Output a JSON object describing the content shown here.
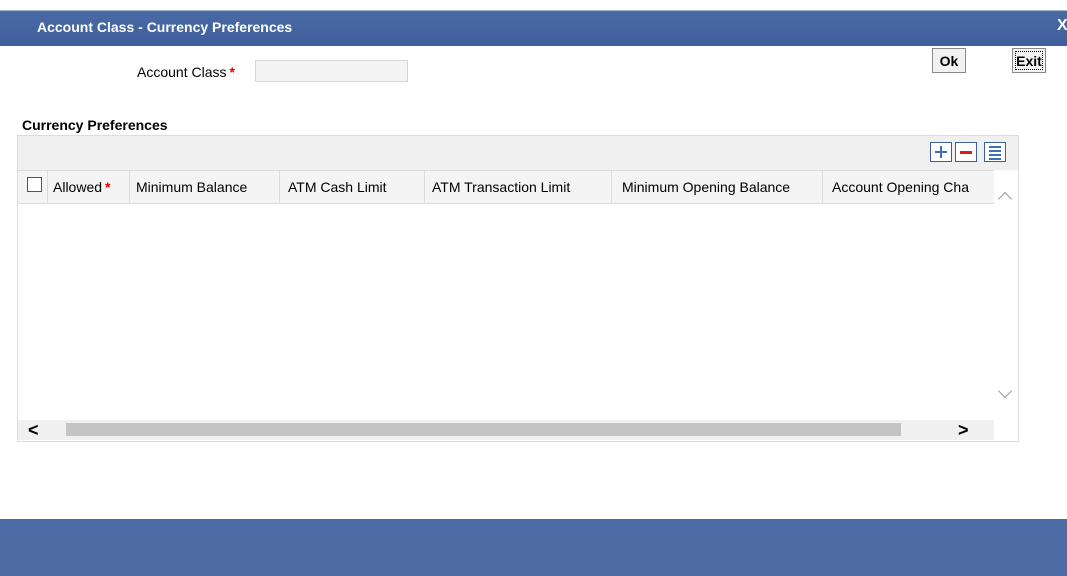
{
  "window": {
    "title": "Account Class - Currency Preferences",
    "close_glyph": "X"
  },
  "form": {
    "account_class_label": "Account Class",
    "required_mark": "*",
    "account_class_value": ""
  },
  "currency_preferences": {
    "section_title": "Currency Preferences",
    "toolbar": {
      "add_icon": "plus-icon",
      "delete_icon": "minus-icon",
      "view_icon": "list-view-icon"
    },
    "columns": [
      {
        "label": "Allowed",
        "required": true
      },
      {
        "label": "Minimum Balance",
        "required": false
      },
      {
        "label": "ATM Cash Limit",
        "required": false
      },
      {
        "label": "ATM Transaction Limit",
        "required": false
      },
      {
        "label": "Minimum Opening Balance",
        "required": false
      },
      {
        "label": "Account Opening Cha",
        "required": false
      }
    ],
    "rows": []
  },
  "footer": {
    "ok_label": "Ok",
    "exit_label": "Exit"
  },
  "colors": {
    "title_bar": "#3f5f9c",
    "footer_bar": "#4d6ba4",
    "required_star": "#e00000",
    "add_icon": "#3b6fb9",
    "delete_icon": "#e01b1b"
  }
}
